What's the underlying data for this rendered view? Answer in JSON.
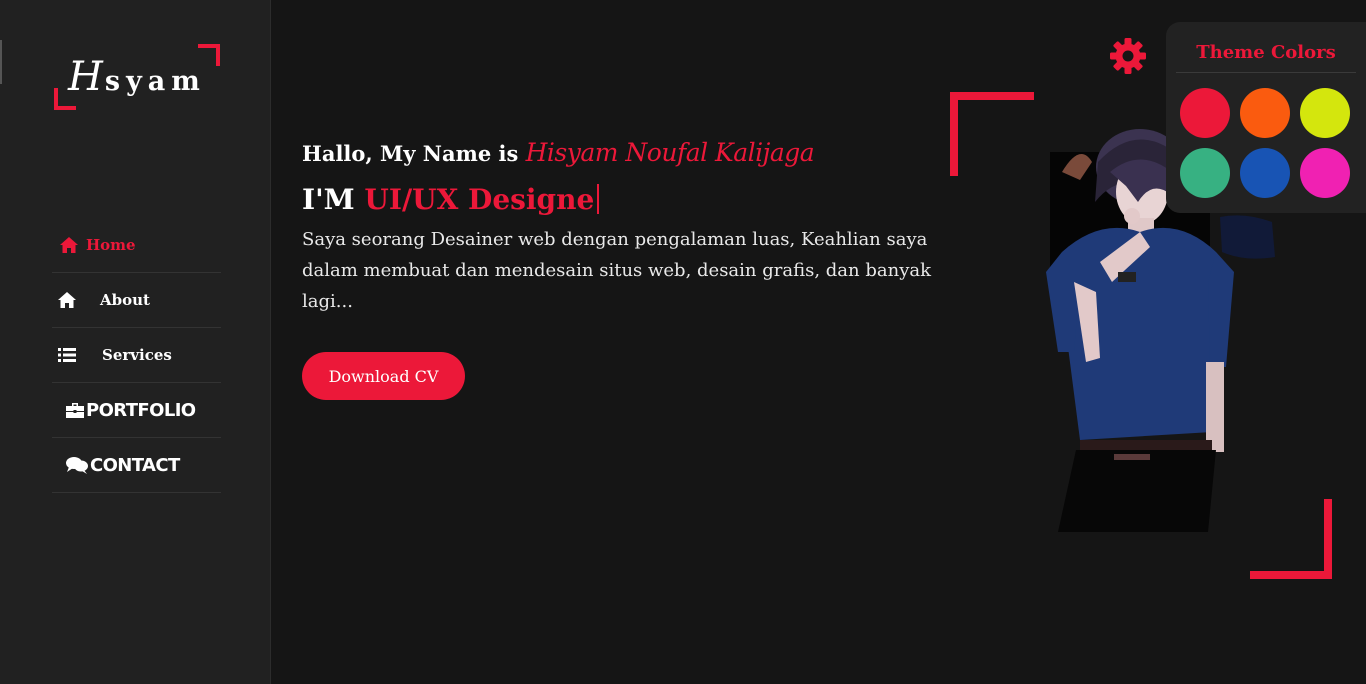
{
  "brand": {
    "logo_initial": "H",
    "logo_rest": "syam",
    "accent": "#ec1839"
  },
  "nav": {
    "items": [
      {
        "label": "Home",
        "icon": "home-icon",
        "active": true
      },
      {
        "label": "About",
        "icon": "home-icon",
        "active": false
      },
      {
        "label": "Services",
        "icon": "list-icon",
        "active": false
      },
      {
        "label": "PORTFOLIO",
        "icon": "briefcase-icon",
        "active": false
      },
      {
        "label": "CONTACT",
        "icon": "comments-icon",
        "active": false
      }
    ]
  },
  "hero": {
    "greeting": "Hallo, My Name is",
    "name": "Hisyam Noufal Kalijaga",
    "role_prefix": "I'M",
    "role": "UI/UX Designe",
    "description": "Saya seorang Desainer web dengan pengalaman luas, Keahlian saya dalam membuat dan mendesain situs web, desain grafis, dan banyak lagi...",
    "cta_label": "Download CV"
  },
  "theme_panel": {
    "title": "Theme Colors",
    "colors": [
      "#ec1839",
      "#fa5b0f",
      "#d4e60d",
      "#37b182",
      "#1854b4",
      "#f021b2"
    ]
  }
}
